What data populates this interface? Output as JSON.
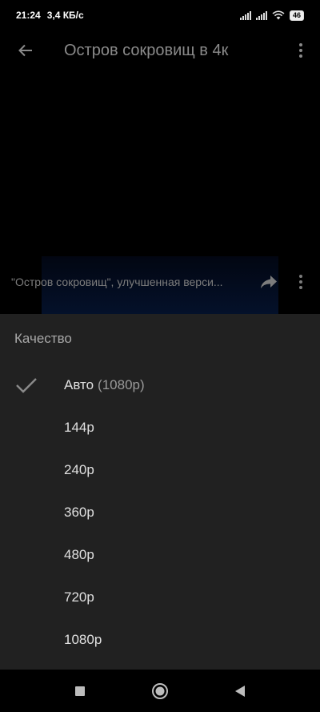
{
  "status_bar": {
    "time": "21:24",
    "net_speed": "3,4 КБ/с",
    "battery": "46"
  },
  "app_bar": {
    "title": "Остров сокровищ в 4к",
    "back_icon": "arrow-left-icon",
    "menu_icon": "more-vertical-icon"
  },
  "video": {
    "caption": "\"Остров сокровищ\", улучшенная верси..."
  },
  "quality_sheet": {
    "title": "Качество",
    "options": [
      {
        "label": "Авто",
        "sub": "(1080p)",
        "selected": true
      },
      {
        "label": "144p",
        "sub": "",
        "selected": false
      },
      {
        "label": "240p",
        "sub": "",
        "selected": false
      },
      {
        "label": "360p",
        "sub": "",
        "selected": false
      },
      {
        "label": "480p",
        "sub": "",
        "selected": false
      },
      {
        "label": "720p",
        "sub": "",
        "selected": false
      },
      {
        "label": "1080p",
        "sub": "",
        "selected": false
      }
    ]
  },
  "colors": {
    "sheet_bg": "#212121",
    "text_primary": "#e0e0e0",
    "text_secondary": "#9a9a9a"
  }
}
